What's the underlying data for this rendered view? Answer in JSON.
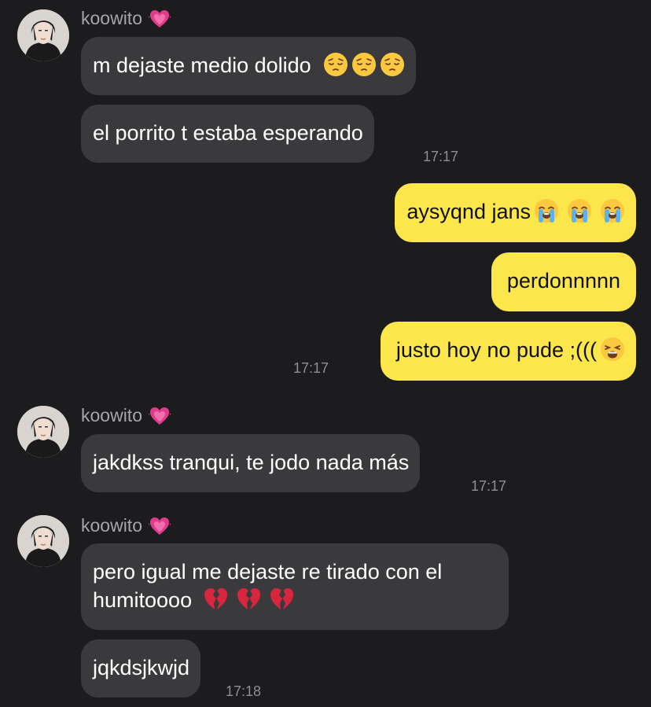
{
  "group1": {
    "sender": "koowito",
    "messages": [
      "m dejaste medio dolido",
      "el porrito t estaba esperando"
    ],
    "time": "17:17"
  },
  "outgoing": {
    "messages": [
      "aysyqnd jans",
      "perdonnnnn",
      "justo hoy no pude ;((("
    ],
    "time": "17:17"
  },
  "group2": {
    "sender": "koowito",
    "messages": [
      "jakdkss tranqui, te jodo nada más"
    ],
    "time": "17:17"
  },
  "group3": {
    "sender": "koowito",
    "messages": [
      "pero igual me dejaste re tirado con el",
      "humitoooo",
      "jqkdsjkwjd"
    ],
    "time": "17:18"
  },
  "icons": {
    "sender_badge": "pink-heart-icon",
    "pensive": "pensive-face-emoji",
    "crying": "loudly-crying-face-emoji",
    "weary": "weary-face-emoji",
    "broken_heart": "broken-heart-emoji"
  },
  "colors": {
    "background": "#1c1c1e",
    "incoming_bubble": "#3a3a3c",
    "outgoing_bubble": "#fbe64c",
    "timestamp": "#8e8e93",
    "sender_name": "#a6a6aa"
  }
}
